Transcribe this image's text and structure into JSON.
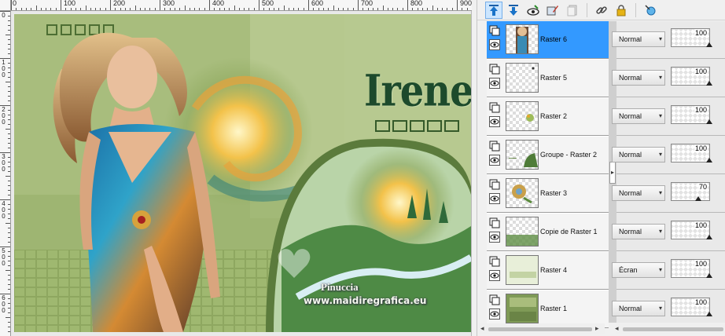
{
  "rulers": {
    "horizontal": [
      "0",
      "100",
      "200",
      "300",
      "400",
      "500",
      "600",
      "700",
      "800",
      "900"
    ],
    "vertical": [
      "0",
      "1 0 0",
      "2 0 0",
      "3 0 0",
      "4 0 0",
      "5 0 0",
      "6 0 0"
    ]
  },
  "artwork": {
    "title": "Irene",
    "credit_name": "Pinuccia",
    "credit_url": "www.maidiregrafica.eu"
  },
  "toolbar": {
    "icons": [
      "move-layer-up-icon",
      "move-layer-down-icon",
      "visibility-icon",
      "edit-layer-icon",
      "delete-layer-icon",
      "link-icon",
      "lock-icon",
      "layer-style-icon"
    ]
  },
  "layers": [
    {
      "name": "Raster 6",
      "blend": "Normal",
      "opacity": "100",
      "selected": true
    },
    {
      "name": "Raster 5",
      "blend": "Normal",
      "opacity": "100",
      "selected": false
    },
    {
      "name": "Raster 2",
      "blend": "Normal",
      "opacity": "100",
      "selected": false
    },
    {
      "name": "Groupe - Raster 2",
      "blend": "Normal",
      "opacity": "100",
      "selected": false
    },
    {
      "name": "Raster 3",
      "blend": "Normal",
      "opacity": "70",
      "selected": false
    },
    {
      "name": "Copie de Raster 1",
      "blend": "Normal",
      "opacity": "100",
      "selected": false
    },
    {
      "name": "Raster 4",
      "blend": "Écran",
      "opacity": "100",
      "selected": false
    },
    {
      "name": "Raster 1",
      "blend": "Normal",
      "opacity": "100",
      "selected": false
    }
  ],
  "colors": {
    "selection": "#3399ff",
    "artwork_green": "#9fb870",
    "title_green": "#1d4a2c"
  }
}
